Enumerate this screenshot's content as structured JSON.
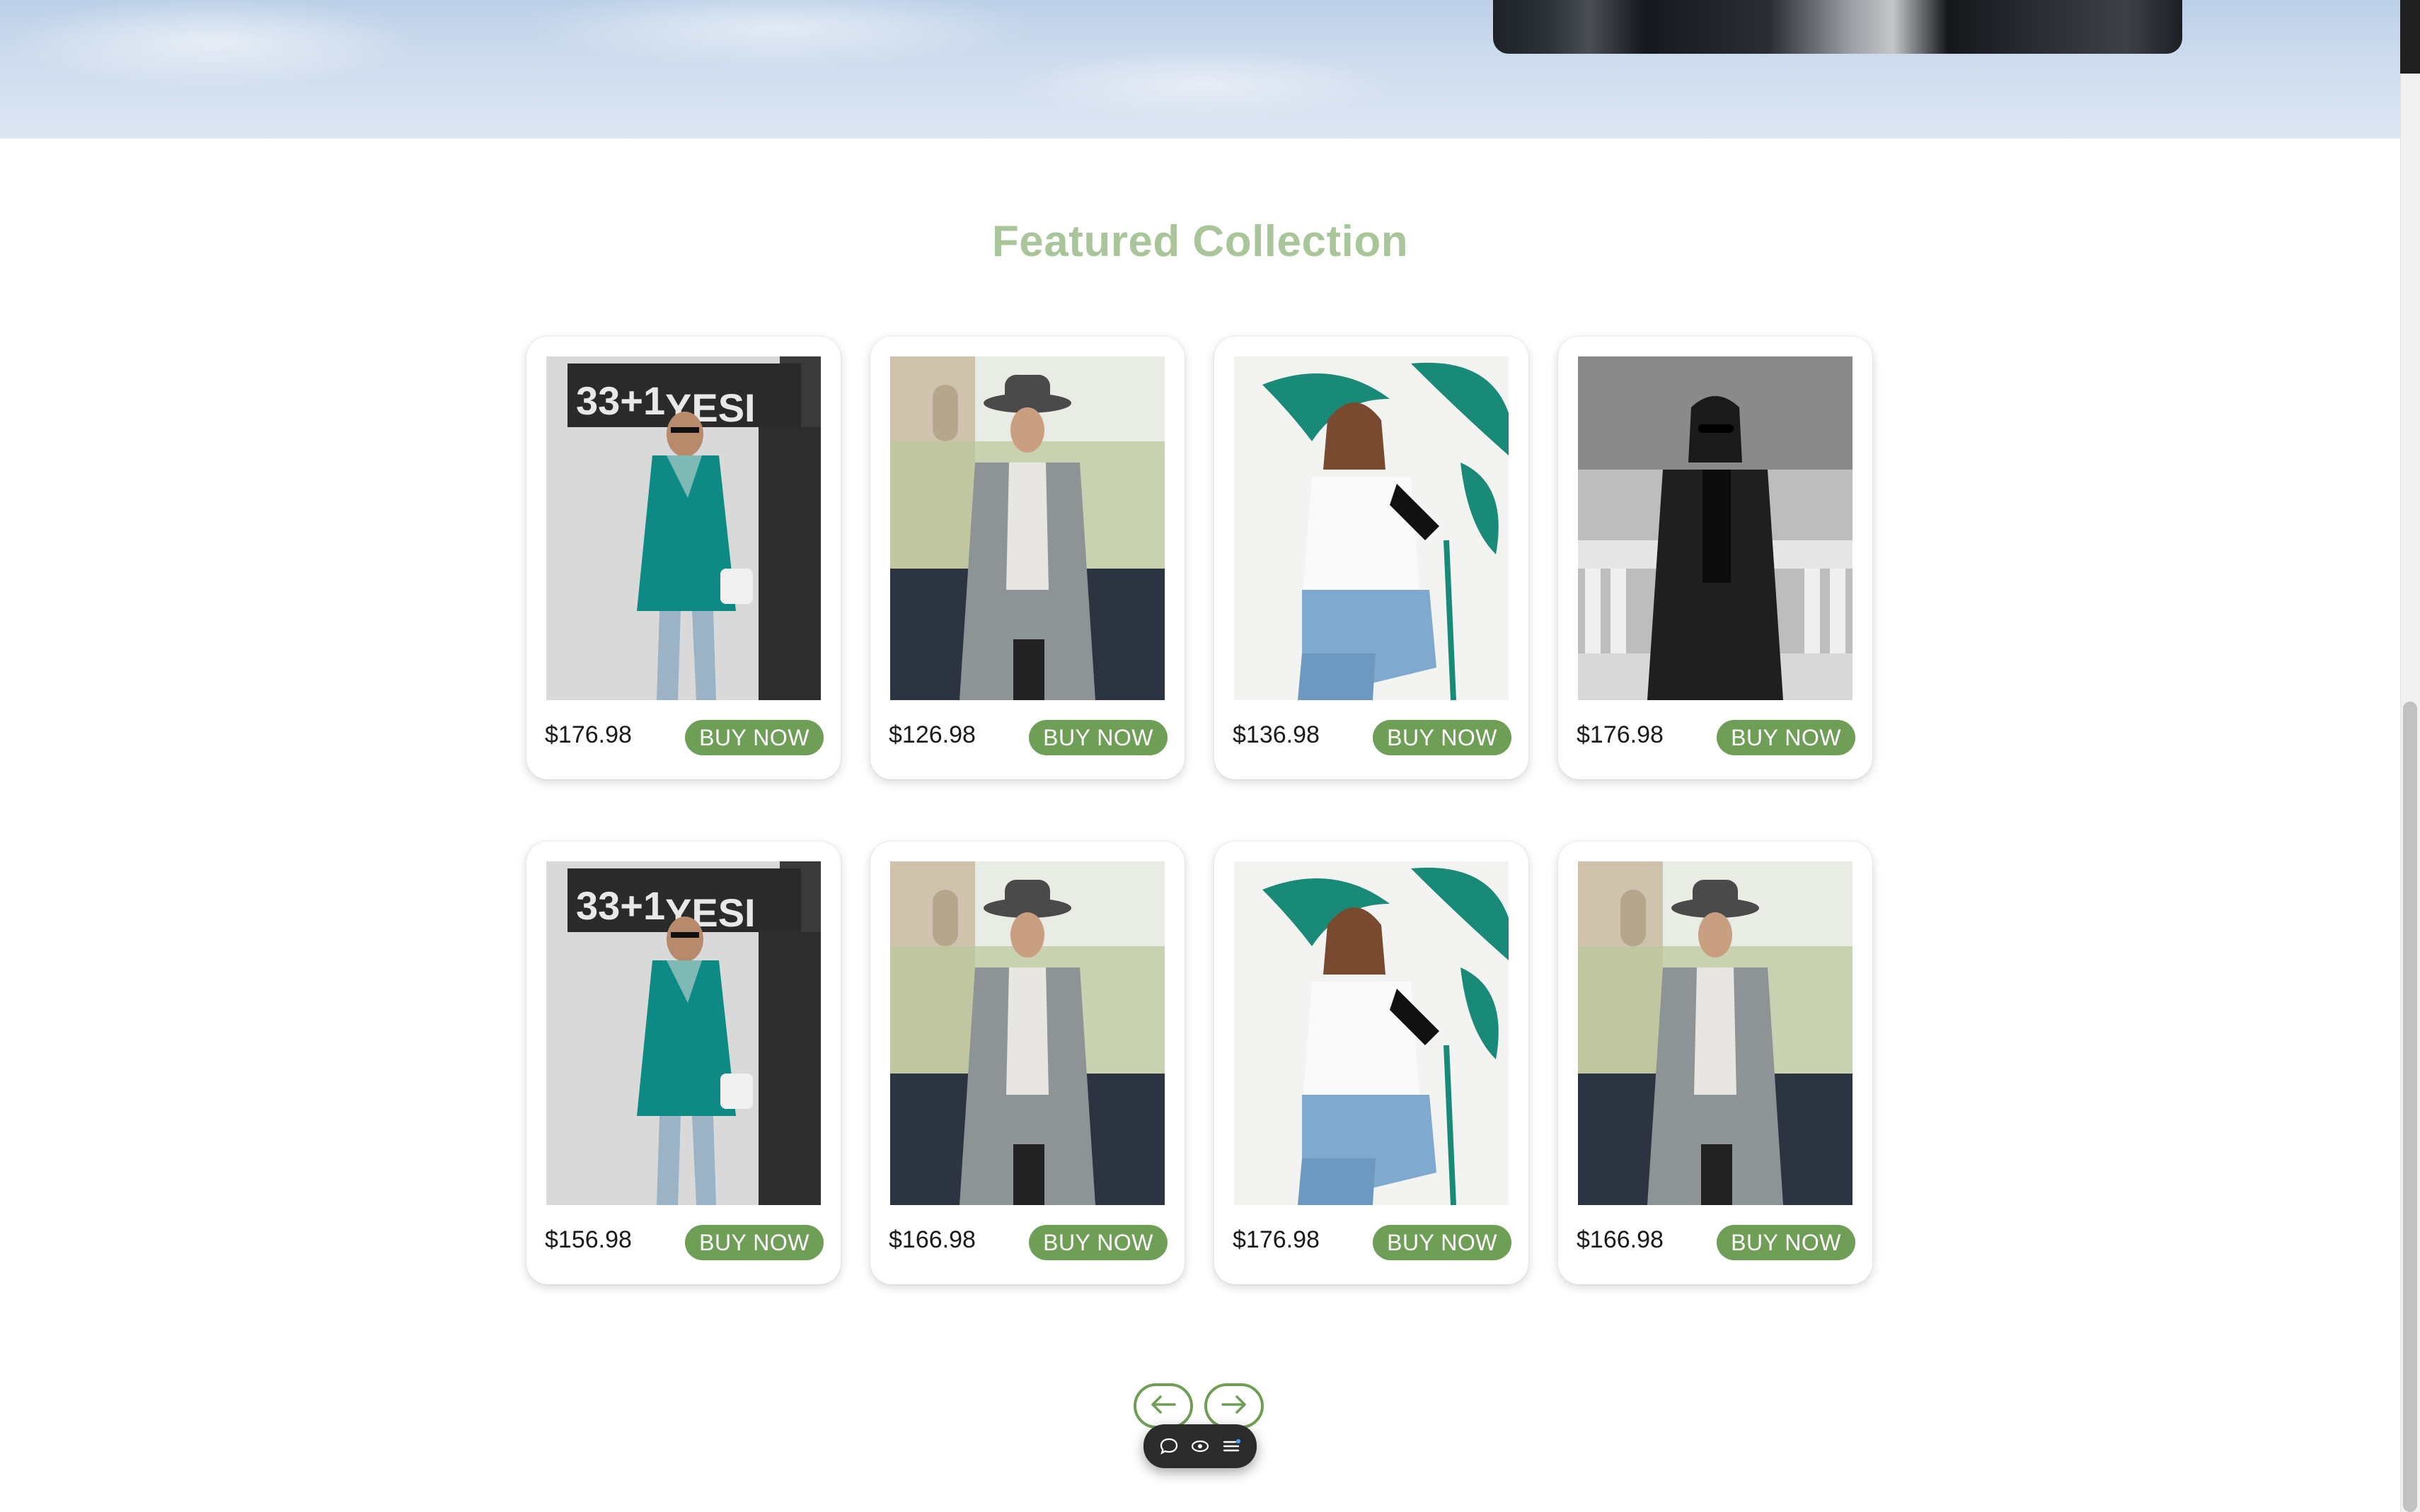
{
  "section": {
    "title": "Featured Collection"
  },
  "products": [
    {
      "price": "$176.98",
      "button": "BUY NOW",
      "image": "woman-teal-coat"
    },
    {
      "price": "$126.98",
      "button": "BUY NOW",
      "image": "woman-gray-coat-hat"
    },
    {
      "price": "$136.98",
      "button": "BUY NOW",
      "image": "woman-white-tee-jeans"
    },
    {
      "price": "$176.98",
      "button": "BUY NOW",
      "image": "woman-black-coat-bw"
    },
    {
      "price": "$156.98",
      "button": "BUY NOW",
      "image": "woman-teal-coat"
    },
    {
      "price": "$166.98",
      "button": "BUY NOW",
      "image": "woman-gray-coat-hat"
    },
    {
      "price": "$176.98",
      "button": "BUY NOW",
      "image": "woman-white-tee-jeans"
    },
    {
      "price": "$166.98",
      "button": "BUY NOW",
      "image": "woman-gray-coat-hat"
    }
  ],
  "pager": {
    "prev_icon": "arrow-left-icon",
    "next_icon": "arrow-right-icon"
  },
  "toolbar": {
    "icons": [
      "comment-icon",
      "eye-icon",
      "menu-icon"
    ]
  },
  "colors": {
    "title": "#a9c59a",
    "accent": "#6f9f56"
  }
}
